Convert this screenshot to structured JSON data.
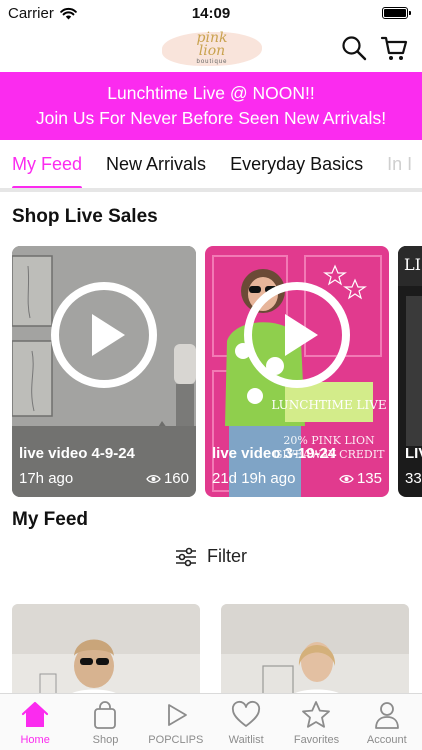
{
  "status_bar": {
    "carrier": "Carrier",
    "time": "14:09"
  },
  "header": {
    "logo_line1": "pink",
    "logo_line2": "lion",
    "logo_subtitle": "boutique"
  },
  "banner": {
    "line1": "Lunchtime Live @ NOON!!",
    "line2": "Join Us For Never Before Seen New Arrivals!"
  },
  "tabs": [
    {
      "label": "My Feed",
      "active": true
    },
    {
      "label": "New Arrivals"
    },
    {
      "label": "Everyday Basics"
    },
    {
      "label": "In I"
    }
  ],
  "shop_live": {
    "title": "Shop Live Sales",
    "cards": [
      {
        "title": "live video 4-9-24",
        "time": "17h ago",
        "views": "160"
      },
      {
        "title": "live video 3-19-24",
        "time": "21d 19h ago",
        "views": "135",
        "overlay_title": "LUNCHTIME LIVE",
        "overlay_text": "20% PINK LION",
        "overlay_text2": "GIVEAWAY CREDIT"
      },
      {
        "title": "LIV",
        "time": "33",
        "overlay_title": "LI"
      }
    ]
  },
  "feed": {
    "title": "My Feed",
    "filter_label": "Filter"
  },
  "bottom_nav": [
    {
      "label": "Home",
      "icon": "home-icon",
      "active": true
    },
    {
      "label": "Shop",
      "icon": "shopping-bag-icon"
    },
    {
      "label": "POPCLIPS",
      "icon": "play-icon"
    },
    {
      "label": "Waitlist",
      "icon": "heart-icon"
    },
    {
      "label": "Favorites",
      "icon": "star-icon"
    },
    {
      "label": "Account",
      "icon": "person-icon"
    }
  ],
  "colors": {
    "accent": "#fb2bef",
    "tab_divider": "#e6e6e6",
    "nav_inactive": "#8c8c8c"
  }
}
